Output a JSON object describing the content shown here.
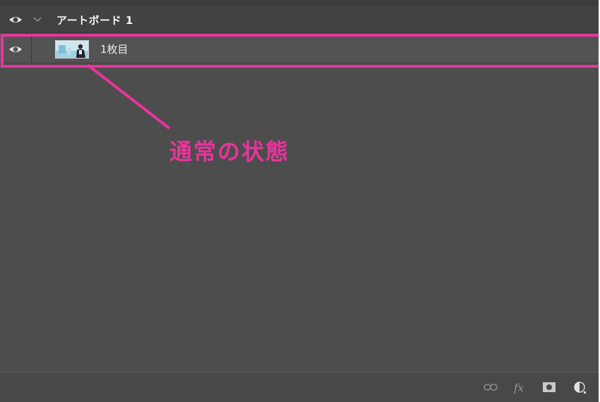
{
  "artboard": {
    "name": "アートボード 1",
    "visibility_icon": "eye-icon",
    "expand_icon": "chevron-down-icon"
  },
  "layer": {
    "name": "1枚目",
    "visibility_icon": "eye-icon",
    "thumbnail": "layer-thumbnail"
  },
  "annotation": {
    "label": "通常の状態",
    "color": "#e8349c"
  },
  "footer": {
    "icons": [
      "link-icon",
      "fx-icon",
      "mask-icon",
      "adjustment-icon"
    ]
  },
  "colors": {
    "panel_bg": "#4d4d4d",
    "selected_row_bg": "#535353",
    "accent": "#e8349c"
  }
}
